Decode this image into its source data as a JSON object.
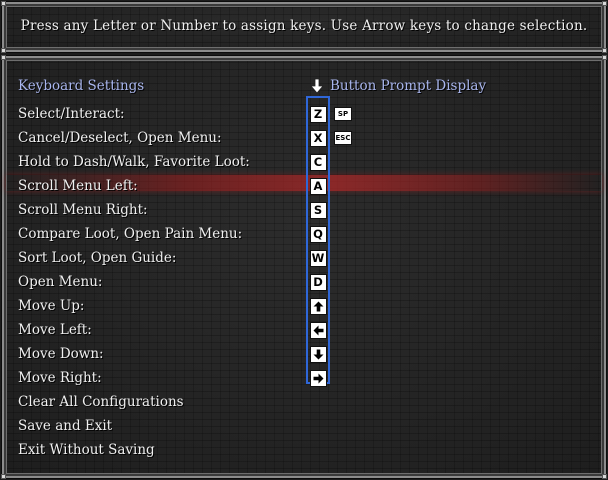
{
  "help": {
    "text": "Press any Letter or Number to assign keys. Use Arrow keys to change selection."
  },
  "header": {
    "left_title": "Keyboard Settings",
    "right_title": "Button Prompt Display",
    "right_icon": "arrow-down-icon"
  },
  "colors": {
    "header_text": "#a9b6ee",
    "column_border": "#2f67d8",
    "selection_glow": "#a02828"
  },
  "selected_index": 3,
  "menu": {
    "items": [
      {
        "label": "Select/Interact:",
        "key": "Z",
        "alt": "SP"
      },
      {
        "label": "Cancel/Deselect, Open Menu:",
        "key": "X",
        "alt": "ESC"
      },
      {
        "label": "Hold to Dash/Walk, Favorite Loot:",
        "key": "C"
      },
      {
        "label": "Scroll Menu Left:",
        "key": "A"
      },
      {
        "label": "Scroll Menu Right:",
        "key": "S"
      },
      {
        "label": "Compare Loot, Open Pain Menu:",
        "key": "Q"
      },
      {
        "label": "Sort Loot, Open Guide:",
        "key": "W"
      },
      {
        "label": "Open Menu:",
        "key": "D"
      },
      {
        "label": "Move Up:",
        "icon": "arrow-up-icon"
      },
      {
        "label": "Move Left:",
        "icon": "arrow-left-icon"
      },
      {
        "label": "Move Down:",
        "icon": "arrow-down-icon"
      },
      {
        "label": "Move Right:",
        "icon": "arrow-right-icon"
      },
      {
        "label": "Clear All Configurations"
      },
      {
        "label": "Save and Exit"
      },
      {
        "label": "Exit Without Saving"
      }
    ]
  }
}
